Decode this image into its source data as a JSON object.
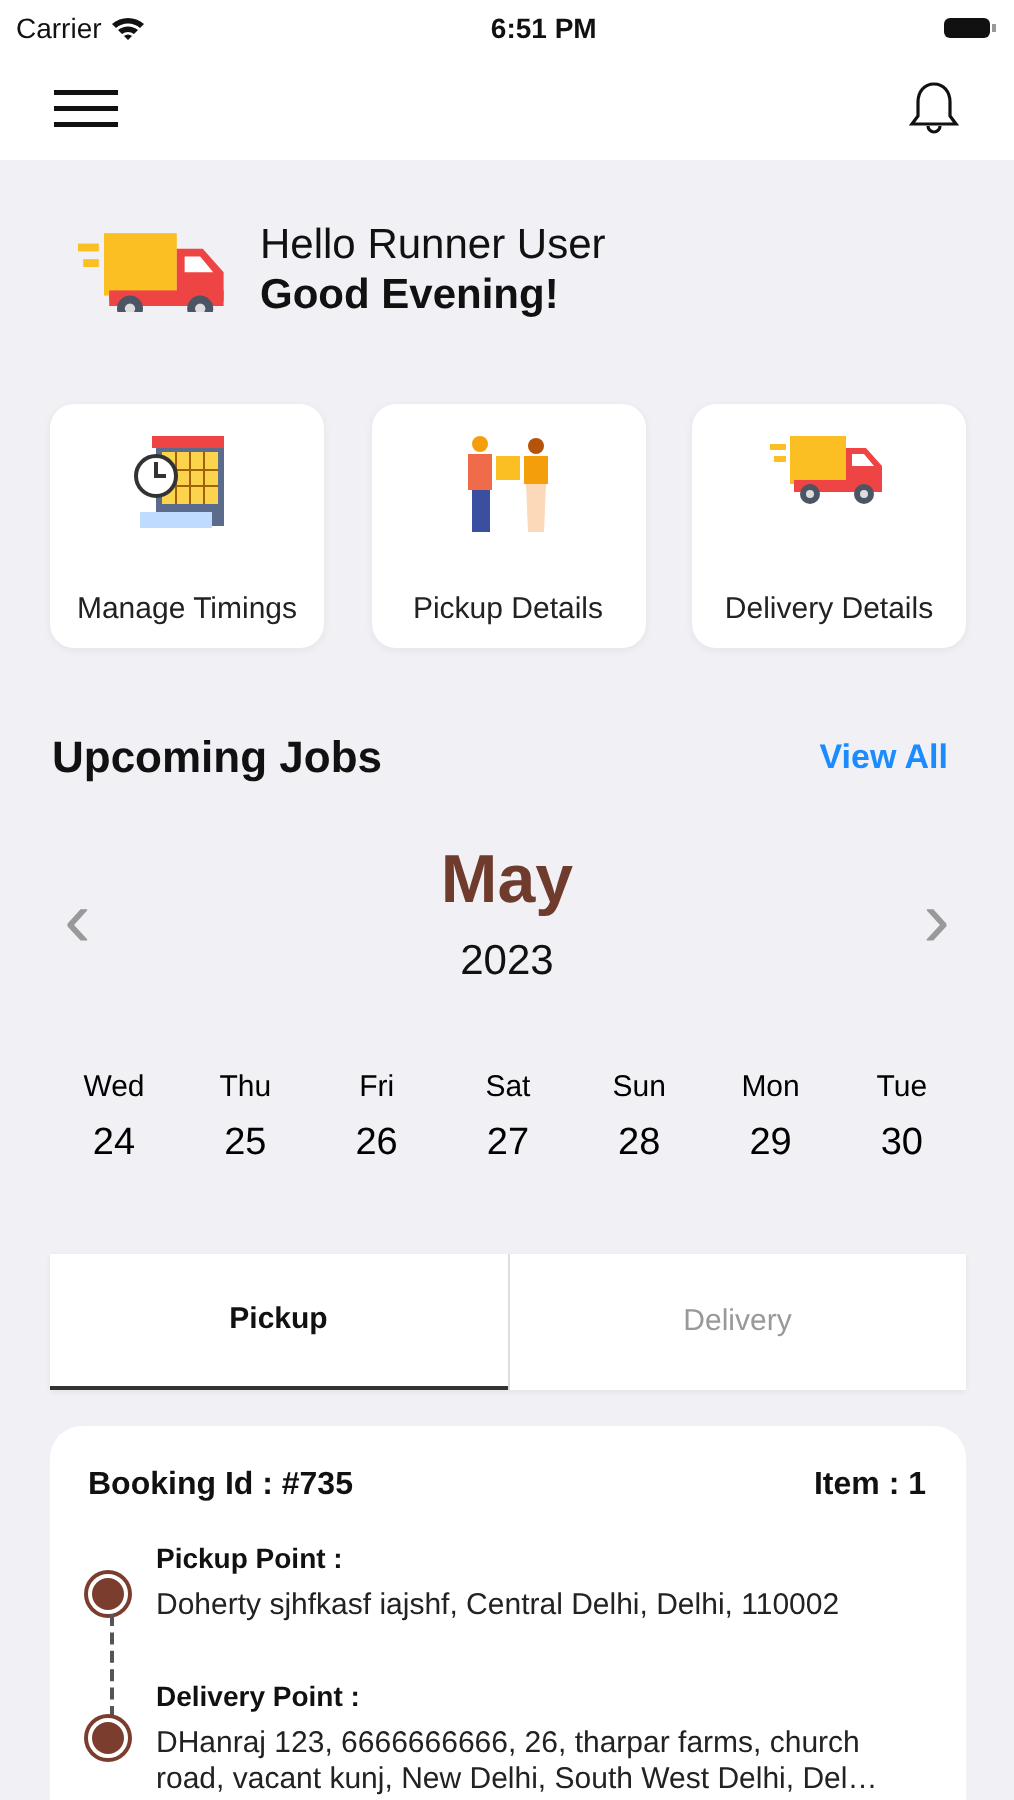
{
  "status_bar": {
    "carrier": "Carrier",
    "time": "6:51 PM"
  },
  "greeting": {
    "hello": "Hello Runner User",
    "message": "Good Evening!"
  },
  "shortcuts": [
    {
      "kind": "timings",
      "label": "Manage Timings"
    },
    {
      "kind": "pickup",
      "label": "Pickup Details"
    },
    {
      "kind": "delivery",
      "label": "Delivery Details"
    }
  ],
  "upcoming": {
    "title": "Upcoming Jobs",
    "link": "View All"
  },
  "calendar": {
    "month": "May",
    "year": "2023",
    "prev": "‹",
    "next": "›",
    "days": [
      {
        "weekday": "Wed",
        "date": "24"
      },
      {
        "weekday": "Thu",
        "date": "25"
      },
      {
        "weekday": "Fri",
        "date": "26"
      },
      {
        "weekday": "Sat",
        "date": "27"
      },
      {
        "weekday": "Sun",
        "date": "28"
      },
      {
        "weekday": "Mon",
        "date": "29"
      },
      {
        "weekday": "Tue",
        "date": "30"
      }
    ]
  },
  "tabs": [
    {
      "label": "Pickup",
      "selected": true
    },
    {
      "label": "Delivery",
      "selected": false
    }
  ],
  "job": {
    "booking": "Booking Id : #735",
    "items": "Item : 1",
    "stops": [
      {
        "label": "Pickup Point :",
        "address": "Doherty sjhfkasf iajshf, Central Delhi, Delhi, 110002"
      },
      {
        "label": "Delivery Point :",
        "address": "DHanraj 123, 6666666666, 26, tharpar farms, church road, vacant kunj, New Delhi, South West Delhi, Del…"
      }
    ]
  }
}
